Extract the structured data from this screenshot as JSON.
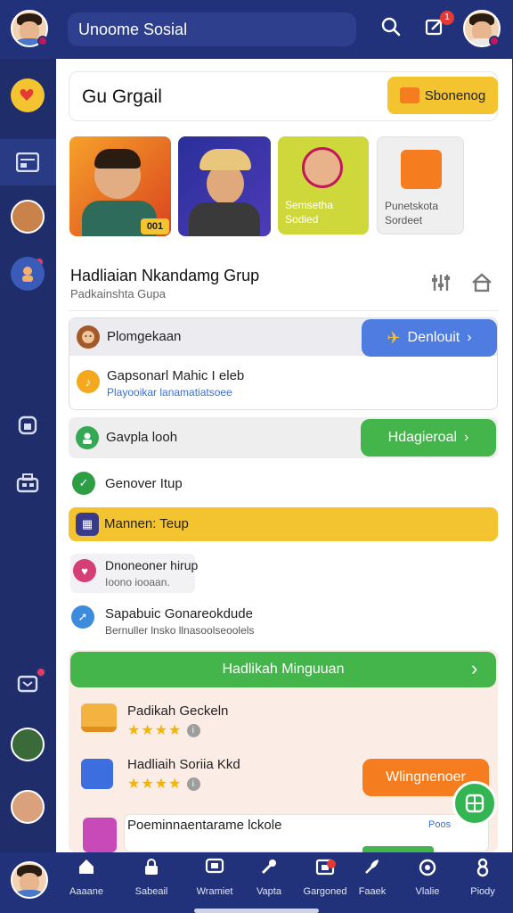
{
  "topbar": {
    "search_text": "Unoome Sosial",
    "notification_count": "1"
  },
  "group": {
    "title": "Gu Grgail",
    "action_label": "Sbonenog"
  },
  "thumbnails": [
    {
      "badge": "001"
    },
    {},
    {
      "label_line1": "Semsetha",
      "label_line2": "Sodied"
    },
    {
      "label_line1": "Punetskota",
      "label_line2": "Sordeet"
    }
  ],
  "section": {
    "title": "Hadliaian Nkandamg Grup",
    "subtitle": "Padkainshta Gupa"
  },
  "rows": {
    "promo_label": "Plomgekaan",
    "promo_button": "Denlouit",
    "music_title": "Gapsonarl Mahic I eleb",
    "music_sub": "Playooikar lanamatiatsoee",
    "couple_label": "Gavpla looh",
    "couple_button": "Hdagieroal",
    "genover_label": "Genover Itup",
    "banner_label": "Mannen: Teup",
    "drummer_title": "Dnoneoner hirup",
    "drummer_sub": "Ioono iooaan.",
    "sapabuic_title": "Sapabuic Gonareokdude",
    "sapabuic_sub": "Bernuller lnsko llnasoolseoolels"
  },
  "rewards": {
    "header": "Hadlikah Minguuan",
    "items": [
      {
        "title": "Padikah Geckeln",
        "stars": "★★★★"
      },
      {
        "title": "Hadliaih Soriia Kkd",
        "stars": "★★★★"
      }
    ],
    "action_button": "Wlingnenoer",
    "partial_title": "Poeminnaentarame lckole",
    "partial_link": "Poos"
  },
  "bottom_nav": [
    {
      "label": "Aaaane",
      "icon": "home-icon"
    },
    {
      "label": "Sabeail",
      "icon": "lock-icon"
    },
    {
      "label": "Wramiet",
      "icon": "tv-icon"
    },
    {
      "label": "Vapta",
      "icon": "tools-icon"
    },
    {
      "label": "Gargoned",
      "icon": "gift-icon"
    },
    {
      "label": "Faaek",
      "icon": "feather-icon"
    },
    {
      "label": "Vlalie",
      "icon": "camera-icon"
    },
    {
      "label": "Piody",
      "icon": "person-icon"
    }
  ],
  "colors": {
    "topbar": "#22327a",
    "blue_button": "#4e7ce0",
    "green_button": "#43b54a",
    "yellow": "#f4c430",
    "orange": "#f57c1f"
  }
}
